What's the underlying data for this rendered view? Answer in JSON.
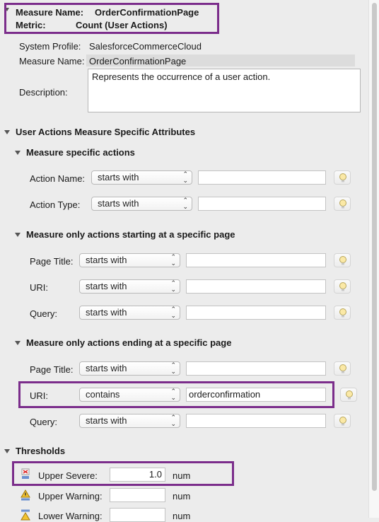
{
  "header": {
    "measure_name_label": "Measure Name:",
    "measure_name_value": "OrderConfirmationPage",
    "metric_label": "Metric:",
    "metric_value": "Count (User Actions)"
  },
  "general": {
    "system_profile_label": "System Profile:",
    "system_profile_value": "SalesforceCommerceCloud",
    "measure_name_label": "Measure Name:",
    "measure_name_value": "OrderConfirmationPage",
    "description_label": "Description:",
    "description_value": "Represents the occurrence of a user action."
  },
  "section_main": {
    "title": "User Actions Measure Specific Attributes"
  },
  "group_actions": {
    "title": "Measure specific actions",
    "rows": [
      {
        "label": "Action Name:",
        "operator": "starts with",
        "value": ""
      },
      {
        "label": "Action Type:",
        "operator": "starts with",
        "value": ""
      }
    ]
  },
  "group_start": {
    "title": "Measure only actions starting at a specific page",
    "rows": [
      {
        "label": "Page Title:",
        "operator": "starts with",
        "value": ""
      },
      {
        "label": "URI:",
        "operator": "starts with",
        "value": ""
      },
      {
        "label": "Query:",
        "operator": "starts with",
        "value": ""
      }
    ]
  },
  "group_end": {
    "title": "Measure only actions ending at a specific page",
    "rows": [
      {
        "label": "Page Title:",
        "operator": "starts with",
        "value": ""
      },
      {
        "label": "URI:",
        "operator": "contains",
        "value": "orderconfirmation"
      },
      {
        "label": "Query:",
        "operator": "starts with",
        "value": ""
      }
    ]
  },
  "thresholds": {
    "title": "Thresholds",
    "upper_severe_label": "Upper Severe:",
    "upper_severe_value": "1.0",
    "upper_warning_label": "Upper Warning:",
    "upper_warning_value": "",
    "lower_warning_label": "Lower Warning:",
    "lower_warning_value": "",
    "unit": "num"
  },
  "colors": {
    "highlight": "#7b2d8b",
    "background": "#ececec"
  },
  "icons": [
    "chevron-down-icon",
    "updown-arrows-icon",
    "lightbulb-icon",
    "severe-icon",
    "warning-icon",
    "lower-warning-icon"
  ]
}
